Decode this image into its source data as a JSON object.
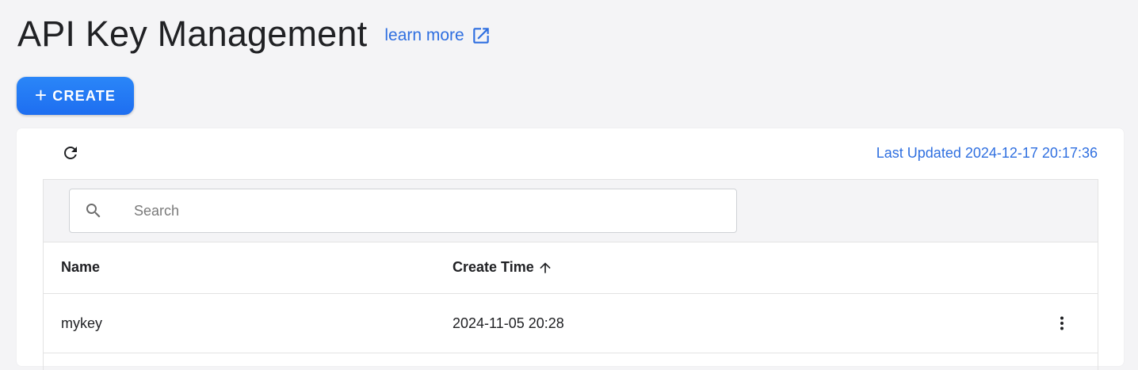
{
  "header": {
    "title": "API Key Management",
    "learn_more": "learn more"
  },
  "toolbar": {
    "create_label": "CREATE",
    "create_icon": "plus-icon"
  },
  "status": {
    "last_updated": "Last Updated 2024-12-17 20:17:36"
  },
  "search": {
    "placeholder": "Search",
    "value": ""
  },
  "table": {
    "columns": [
      {
        "label": "Name"
      },
      {
        "label": "Create Time",
        "sort": "ascending"
      }
    ],
    "rows": [
      {
        "name": "mykey",
        "create_time": "2024-11-05 20:28"
      }
    ]
  },
  "colors": {
    "accent": "#2f6fe0",
    "button": "#2279f5",
    "background": "#f4f4f6"
  }
}
